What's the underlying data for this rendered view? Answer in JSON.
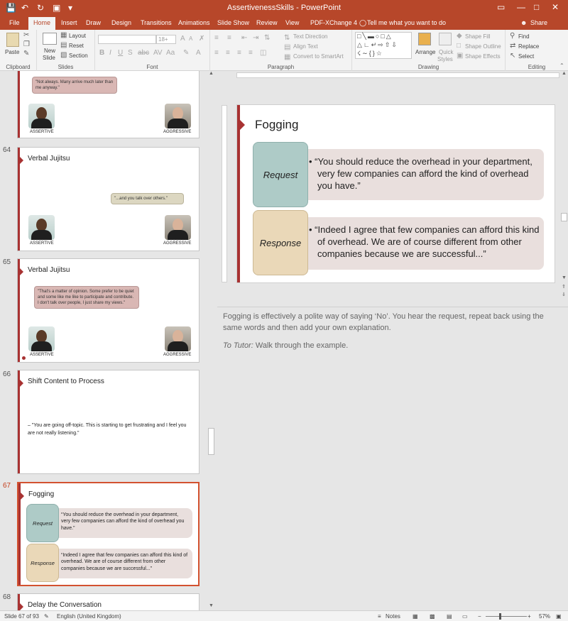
{
  "app": {
    "window_title": "AssertivenessSkills - PowerPoint",
    "share_label": "Share",
    "tell_me": "Tell me what you want to do"
  },
  "tabs": [
    "File",
    "Home",
    "Insert",
    "Draw",
    "Design",
    "Transitions",
    "Animations",
    "Slide Show",
    "Review",
    "View",
    "PDF-XChange 4"
  ],
  "ribbon": {
    "paste": "Paste",
    "new_slide": "New",
    "new_slide_2": "Slide",
    "layout": "Layout",
    "reset": "Reset",
    "section": "Section",
    "font_size": "18+",
    "text_direction": "Text Direction",
    "align_text": "Align Text",
    "convert_smartart": "Convert to SmartArt",
    "arrange": "Arrange",
    "quick_styles": "Quick",
    "quick_styles_2": "Styles",
    "shape_fill": "Shape Fill",
    "shape_outline": "Shape Outline",
    "shape_effects": "Shape Effects",
    "find": "Find",
    "replace": "Replace",
    "select": "Select",
    "groups": {
      "clipboard": "Clipboard",
      "slides": "Slides",
      "font": "Font",
      "paragraph": "Paragraph",
      "drawing": "Drawing",
      "editing": "Editing"
    }
  },
  "thumbs": {
    "s63": {
      "bubble": "\"Not always. Many arrive much later than me anyway.\"",
      "assertive": "ASSERTIVE",
      "aggressive": "AGGRESSIVE"
    },
    "s64": {
      "num": "64",
      "title": "Verbal Jujitsu",
      "bubble": "\"...and you talk over others.\"",
      "assertive": "ASSERTIVE",
      "aggressive": "AGGRESSIVE"
    },
    "s65": {
      "num": "65",
      "title": "Verbal Jujitsu",
      "bubble": "\"That's a matter of opinion. Some prefer to be quiet and some like me like to participate and contribute. I don't talk over people, I just share my views.\"",
      "assertive": "ASSERTIVE",
      "aggressive": "AGGRESSIVE"
    },
    "s66": {
      "num": "66",
      "title": "Shift Content to Process",
      "body": "– \"You are going off-topic. This is starting to get frustrating and I feel you are not really listening.\""
    },
    "s67": {
      "num": "67",
      "title": "Fogging"
    },
    "s68": {
      "num": "68",
      "title": "Delay the Conversation"
    }
  },
  "slide": {
    "title": "Fogging",
    "request_label": "Request",
    "request_text": "“You should reduce the overhead in your department, very few companies can afford the kind of overhead you have.”",
    "response_label": "Response",
    "response_text": "“Indeed I agree that few companies can afford this kind of overhead. We are of course different from other companies because we are successful...”"
  },
  "notes": {
    "line1": "Fogging is effectively a polite way of saying ‘No’. You hear the request, repeat back using the same words and then add your own explanation.",
    "tutor_label": "To Tutor:",
    "tutor_text": " Walk through the example."
  },
  "status": {
    "slide_counter": "Slide 67 of 93",
    "language": "English (United Kingdom)",
    "notes_label": "Notes",
    "zoom": "57%"
  },
  "colors": {
    "accent": "#b7472a",
    "slide_bar": "#a83232",
    "request_fill": "#aecbc7",
    "response_fill": "#ead8b8",
    "text_box_fill": "#e9dfdd"
  }
}
